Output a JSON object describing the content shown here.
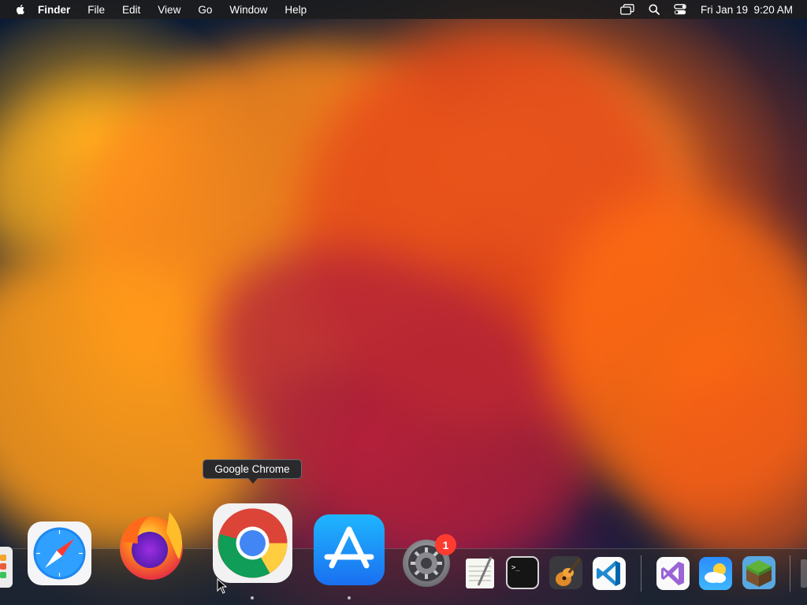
{
  "menubar": {
    "apple_icon": "apple-logo-icon",
    "app_name": "Finder",
    "menus": [
      "File",
      "Edit",
      "View",
      "Go",
      "Window",
      "Help"
    ],
    "status_icons": [
      "screen-mirroring-icon",
      "spotlight-search-icon",
      "control-center-icon"
    ],
    "datetime": "Fri Jan 19  9:20 AM"
  },
  "tooltip": {
    "text": "Google Chrome"
  },
  "dock": {
    "apps": [
      {
        "name": "Launchpad",
        "icon": "launchpad-icon"
      },
      {
        "name": "Safari",
        "icon": "safari-icon"
      },
      {
        "name": "Firefox",
        "icon": "firefox-icon"
      },
      {
        "name": "Google Chrome",
        "icon": "chrome-icon",
        "running": true
      },
      {
        "name": "App Store",
        "icon": "app-store-icon",
        "running": true
      },
      {
        "name": "System Settings",
        "icon": "system-settings-icon",
        "badge": "1"
      },
      {
        "name": "TextEdit",
        "icon": "textedit-icon"
      },
      {
        "name": "Terminal",
        "icon": "terminal-icon"
      },
      {
        "name": "GarageBand",
        "icon": "garageband-icon"
      },
      {
        "name": "Visual Studio Code",
        "icon": "vscode-icon"
      },
      {
        "name": "Visual Studio",
        "icon": "visual-studio-icon"
      },
      {
        "name": "Weather",
        "icon": "weather-icon"
      },
      {
        "name": "Minecraft",
        "icon": "minecraft-icon"
      }
    ]
  },
  "colors": {
    "menubar_bg": "#1c1c1e",
    "badge_red": "#ff3b30",
    "wallpaper_accent": "#ff7a18"
  }
}
